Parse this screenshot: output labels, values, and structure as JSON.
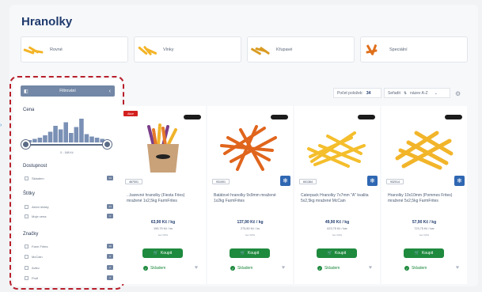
{
  "page": {
    "title": "Hranolky"
  },
  "categories": [
    {
      "label": "Rovné",
      "icon": "straight-fries-icon"
    },
    {
      "label": "Vlnky",
      "icon": "wavy-fries-icon"
    },
    {
      "label": "Křupavé",
      "icon": "crispy-fries-icon"
    },
    {
      "label": "Speciální",
      "icon": "special-fries-icon"
    }
  ],
  "sidebar": {
    "filter_label": "Filtrování",
    "price": {
      "title": "Cena",
      "range": "0 - 188 Kč",
      "histogram": [
        2,
        3,
        4,
        6,
        9,
        14,
        11,
        17,
        8,
        13,
        20,
        7,
        5,
        4,
        3,
        2
      ]
    },
    "availability": {
      "title": "Dostupnost",
      "items": [
        {
          "label": "Skladem",
          "count": "14"
        }
      ]
    },
    "labels": {
      "title": "Štítky",
      "items": [
        {
          "label": "Akční letáky",
          "count": "14"
        },
        {
          "label": "Moje cena",
          "count": "4"
        }
      ]
    },
    "brands": {
      "title": "Značky",
      "items": [
        {
          "label": "Farm Frites",
          "count": "19"
        },
        {
          "label": "McCain",
          "count": "3"
        },
        {
          "label": "Aviko",
          "count": "2"
        },
        {
          "label": "Profi",
          "count": "4"
        }
      ]
    }
  },
  "toolbar": {
    "count_label": "Počet položek:",
    "count_value": "34",
    "sort_label": "Seřadit",
    "sort_value": "název A-Z"
  },
  "products": [
    {
      "sale_tag": "Akce",
      "code": "467001",
      "name": "...barevné hranolky (Fiesta Fries) mražené 1x2,5kg FarmFrites",
      "price": "63,90 Kč / kg",
      "unit_price": "159,75 Kč / ks",
      "vat": "bez DPH",
      "buy_label": "Koupit",
      "stock_label": "Skladem"
    },
    {
      "code": "931001",
      "name": "Batátové hranolky 9x9mm mražené 1x2kg FarmFrites",
      "price": "137,90 Kč / kg",
      "unit_price": "275,80 Kč / ks",
      "vat": "bez DPH",
      "buy_label": "Koupit",
      "stock_label": "Skladem"
    },
    {
      "code": "601364",
      "name": "Caterpack Hranolky 7x7mm \"A\" kvalita 5x2,5kg mražené McCain",
      "price": "49,90 Kč / kg",
      "unit_price": "623,75 Kč / kar",
      "vat": "bez DPH",
      "buy_label": "Koupit",
      "stock_label": "Skladem"
    },
    {
      "code": "932014",
      "name": "Hranolky 10x10mm (Pommes Frites) mražené 5x2,5kg FarmFrites",
      "price": "57,90 Kč / kg",
      "unit_price": "723,75 Kč / kar",
      "vat": "bez DPH",
      "buy_label": "Koupit",
      "stock_label": "Skladem"
    }
  ]
}
